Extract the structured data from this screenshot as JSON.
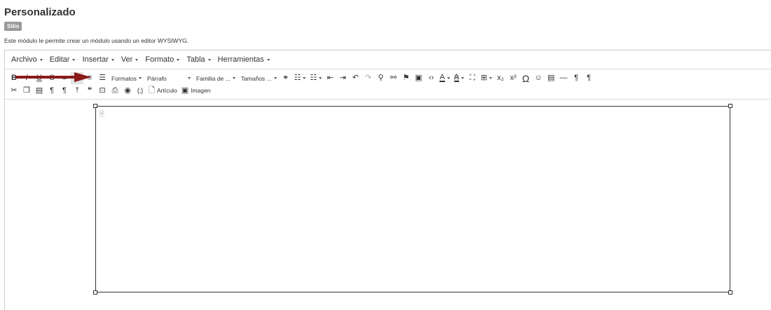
{
  "header": {
    "title": "Personalizado",
    "badge": "Sitio",
    "description": "Este módulo le permite crear un módulo usando un editor WYSIWYG."
  },
  "menubar": [
    "Archivo",
    "Editar",
    "Insertar",
    "Ver",
    "Formato",
    "Tabla",
    "Herramientas"
  ],
  "toolbar": {
    "bold": "B",
    "italic": "I",
    "underline": "U",
    "strike": "S",
    "formats": "Formatos",
    "paragraph": "Párrafo",
    "font_family": "Familia de ...",
    "font_size": "Tamaños ...",
    "text_color_glyph": "A",
    "bg_color_glyph": "A",
    "subscript": "x₂",
    "superscript": "x²",
    "special_char": "Ω",
    "article_button": "Artículo",
    "image_button": "Imagen"
  },
  "colors": {
    "accent_arrow": "#8b1a1a",
    "border": "#333333",
    "badge_bg": "#999999"
  }
}
